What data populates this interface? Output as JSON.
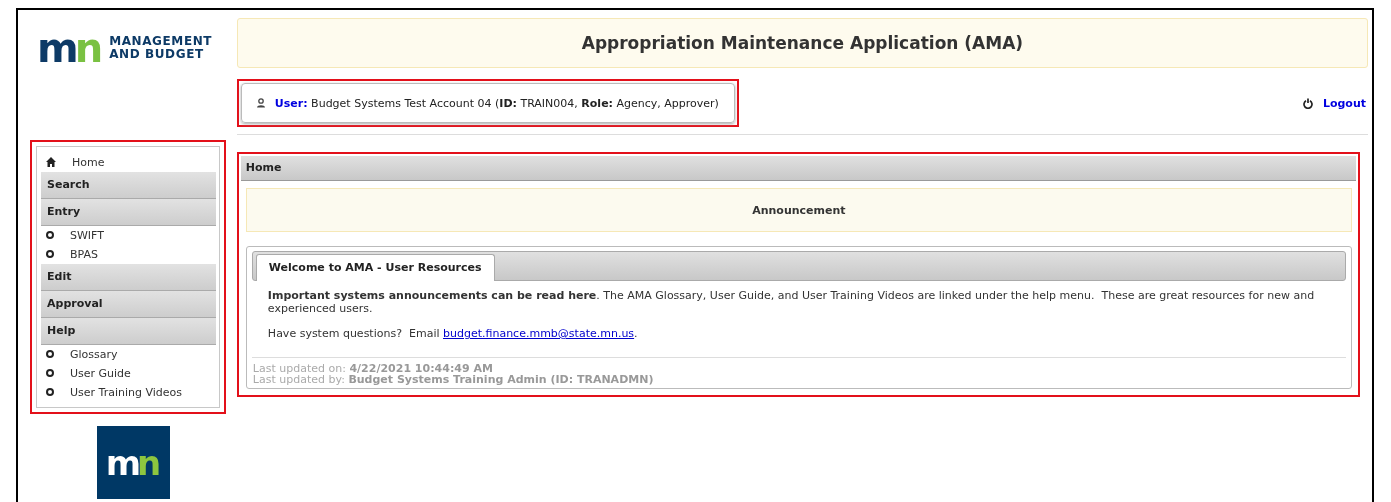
{
  "logo": {
    "mark": "mn",
    "line1": "MANAGEMENT",
    "line2": "AND BUDGET"
  },
  "banner": {
    "title": "Appropriation Maintenance Application (AMA)"
  },
  "user_info": "**User:** Budget Systems Test Account 04 (**ID:** TRAIN004, **Role:** Agency, Approver)",
  "logout": "Logout",
  "sidebar": {
    "items": [
      {
        "kind": "home",
        "label": "Home"
      },
      {
        "kind": "section",
        "label": "Search"
      },
      {
        "kind": "section",
        "label": "Entry"
      },
      {
        "kind": "bullet",
        "label": "SWIFT"
      },
      {
        "kind": "bullet",
        "label": "BPAS"
      },
      {
        "kind": "section",
        "label": "Edit"
      },
      {
        "kind": "section",
        "label": "Approval"
      },
      {
        "kind": "section",
        "label": "Help"
      },
      {
        "kind": "bullet",
        "label": "Glossary"
      },
      {
        "kind": "bullet",
        "label": "User Guide"
      },
      {
        "kind": "bullet",
        "label": "User Training Videos"
      }
    ]
  },
  "bottom_logo": {
    "mark": "mn"
  },
  "panel": {
    "title": "Home",
    "announcement": "Announcement",
    "tabs": [
      {
        "label": "Welcome to AMA - User Resources",
        "selected": true
      }
    ],
    "intro": "**Important systems announcements can be read here**. The AMA Glossary, User Guide, and User Training Videos are linked under the help menu.  These are great resources for new and experienced users.",
    "question": {
      "text": "Have system questions?  Email ",
      "link": "budget.finance.mmb@state.mn.us",
      "after": "."
    },
    "updated_on": "Last updated on: **4/22/2021 10:44:49 AM**",
    "updated_by": "Last updated by: **Budget Systems Training Admin (ID: TRANADMN)**"
  }
}
